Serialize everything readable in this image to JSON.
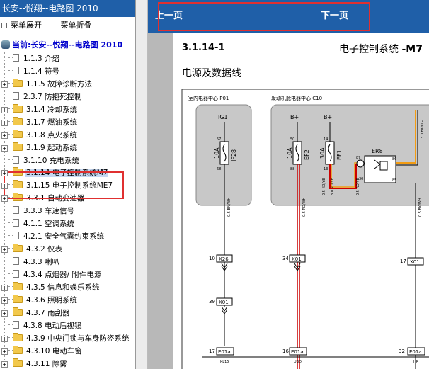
{
  "sidebar": {
    "title": "长安--悦翔--电路图 2010",
    "toolbar": {
      "expand": "菜单展开",
      "collapse": "菜单折叠"
    },
    "root": "当前:长安--悦翔--电路图 2010",
    "items": [
      {
        "label": "1.1.3 介绍",
        "expander": false,
        "icon": "doc"
      },
      {
        "label": "1.1.4 符号",
        "expander": false,
        "icon": "doc"
      },
      {
        "label": "1.1.5 故障诊断方法",
        "expander": true,
        "icon": "folder"
      },
      {
        "label": "2.3.7 防抱死控制",
        "expander": false,
        "icon": "doc"
      },
      {
        "label": "3.1.4 冷却系统",
        "expander": true,
        "icon": "folder"
      },
      {
        "label": "3.1.7 燃油系统",
        "expander": true,
        "icon": "folder"
      },
      {
        "label": "3.1.8 点火系统",
        "expander": true,
        "icon": "folder"
      },
      {
        "label": "3.1.9 起动系统",
        "expander": true,
        "icon": "folder"
      },
      {
        "label": "3.1.10 充电系统",
        "expander": false,
        "icon": "doc"
      },
      {
        "label": "3.1.14 电子控制系统M7",
        "expander": true,
        "icon": "folder",
        "selected": true
      },
      {
        "label": "3.1.15 电子控制系统ME7",
        "expander": true,
        "icon": "folder"
      },
      {
        "label": "3.3.1 自动变速器",
        "expander": true,
        "icon": "folder"
      },
      {
        "label": "3.3.3 车速信号",
        "expander": false,
        "icon": "doc"
      },
      {
        "label": "4.1.1 空调系统",
        "expander": false,
        "icon": "doc"
      },
      {
        "label": "4.2.1 安全气囊约束系统",
        "expander": false,
        "icon": "doc"
      },
      {
        "label": "4.3.2 仪表",
        "expander": true,
        "icon": "folder"
      },
      {
        "label": "4.3.3 喇叭",
        "expander": false,
        "icon": "doc"
      },
      {
        "label": "4.3.4 点烟器/ 附件电源",
        "expander": false,
        "icon": "doc"
      },
      {
        "label": "4.3.5 信息和娱乐系统",
        "expander": true,
        "icon": "folder"
      },
      {
        "label": "4.3.6 照明系统",
        "expander": true,
        "icon": "folder"
      },
      {
        "label": "4.3.7 雨刮器",
        "expander": true,
        "icon": "folder"
      },
      {
        "label": "4.3.8 电动后视镜",
        "expander": false,
        "icon": "doc"
      },
      {
        "label": "4.3.9 中央门锁与车身防盗系统",
        "expander": true,
        "icon": "folder"
      },
      {
        "label": "4.3.10 电动车窗",
        "expander": true,
        "icon": "folder"
      },
      {
        "label": "4.3.11 除雾",
        "expander": true,
        "icon": "folder"
      }
    ]
  },
  "nav": {
    "prev": "上一页",
    "next": "下一页"
  },
  "page": {
    "section": "3.1.14-1",
    "title_prefix": "电子控制系统 ",
    "title_suffix": "-M7",
    "subtitle": "电源及数据线"
  },
  "diagram": {
    "box_left_label": "室内电器中心  P01",
    "box_right_label": "发动机舱电器中心  C10",
    "ig1": "IG1",
    "bplus1": "B+",
    "bplus2": "B+",
    "fuse1_amp": "10A",
    "fuse1_name": "IF28",
    "fuse1_pin_top": "57",
    "fuse1_pin_bot": "68",
    "fuse2_amp": "10A",
    "fuse2_name": "EF2",
    "fuse2_pin_top": "50",
    "fuse2_pin_bot": "88",
    "fuse3_amp": "30A",
    "fuse3_name": "EF1",
    "fuse3_pin_top": "14",
    "fuse3_pin_bot": "13",
    "relay_name": "ER8",
    "relay_pin_a": "87",
    "relay_pin_b": "30",
    "relay_pin_c": "86",
    "relay_pin_d": "85",
    "wire1": "0.5 BN/WH",
    "wire2": "0.5 RD/WH",
    "wire3": "0.5 KO/YE",
    "wire4": "3.0 RD/YE",
    "wire5": "0.5 RD/YE",
    "wire6": "0.5 BK/WH",
    "wire7": "3.0 BK/OG",
    "conn1_pin": "10",
    "conn1": "X26",
    "conn2_pin": "34",
    "conn2": "X01",
    "conn3_pin": "17",
    "conn3": "X01",
    "conn4_pin": "39",
    "conn4": "X01",
    "ecu1_pin": "17",
    "ecu1": "E01a",
    "ecu2_pin": "16",
    "ecu2": "E01a",
    "ecu3_pin": "32",
    "ecu3": "E01a",
    "ecu1_sig": "KL15",
    "ecu2_sig": "UBD",
    "ecu3_sig": "HR"
  }
}
